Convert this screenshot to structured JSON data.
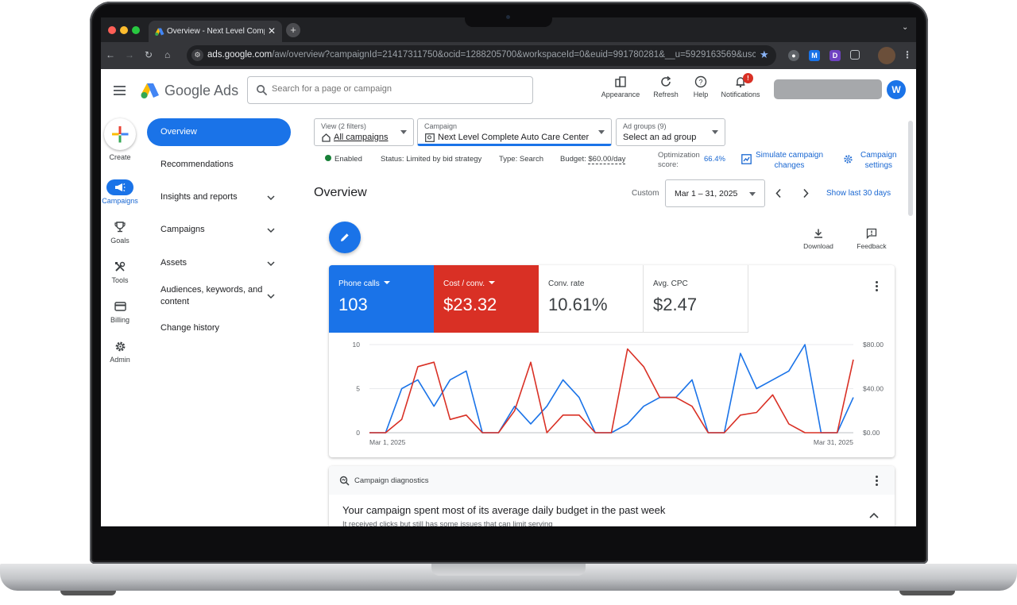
{
  "browser": {
    "tab_title": "Overview - Next Level Complete",
    "tab_close": "✕",
    "new_tab": "+",
    "url_host": "ads.google.com",
    "url_path": "/aw/overview?campaignId=21417311750&ocid=1288205700&workspaceId=0&euid=991780281&__u=5929163569&uscid=128..."
  },
  "header": {
    "brand": "Google Ads",
    "search_placeholder": "Search for a page or campaign",
    "icons": [
      {
        "label": "Appearance",
        "icon": "appearance-icon"
      },
      {
        "label": "Refresh",
        "icon": "refresh-icon"
      },
      {
        "label": "Help",
        "icon": "help-icon"
      },
      {
        "label": "Notifications",
        "icon": "bell-icon",
        "badge": "!"
      }
    ],
    "avatar_letter": "W"
  },
  "rail": {
    "items": [
      {
        "label": "Create",
        "icon": "plus-icon"
      },
      {
        "label": "Campaigns",
        "icon": "megaphone-icon",
        "active": true
      },
      {
        "label": "Goals",
        "icon": "trophy-icon"
      },
      {
        "label": "Tools",
        "icon": "tools-icon"
      },
      {
        "label": "Billing",
        "icon": "credit-card-icon"
      },
      {
        "label": "Admin",
        "icon": "gear-icon"
      }
    ]
  },
  "nav": {
    "items": [
      {
        "label": "Overview",
        "active": true
      },
      {
        "label": "Recommendations"
      },
      {
        "label": "Insights and reports",
        "expandable": true
      },
      {
        "label": "Campaigns",
        "expandable": true
      },
      {
        "label": "Assets",
        "expandable": true
      },
      {
        "label": "Audiences, keywords, and content",
        "expandable": true
      },
      {
        "label": "Change history"
      }
    ]
  },
  "filters": {
    "view_label": "View (2 filters)",
    "view_value": "All campaigns",
    "campaign_label": "Campaign",
    "campaign_value": "Next Level Complete Auto Care Center",
    "adgroup_label": "Ad groups (9)",
    "adgroup_value": "Select an ad group"
  },
  "status": {
    "enabled": "Enabled",
    "status": "Status: Limited by bid strategy",
    "type": "Type: Search",
    "budget_label": "Budget:",
    "budget_value": "$60.00/day",
    "opt_label_1": "Optimization",
    "opt_label_2": "score:",
    "opt_value": "66.4%",
    "simulate_1": "Simulate campaign",
    "simulate_2": "changes",
    "settings_1": "Campaign",
    "settings_2": "settings"
  },
  "overview": {
    "title": "Overview",
    "custom": "Custom",
    "date_range": "Mar 1 – 31, 2025",
    "show_last": "Show last 30 days",
    "download": "Download",
    "feedback": "Feedback"
  },
  "metrics": [
    {
      "label": "Phone calls",
      "value": "103",
      "color": "#1a73e8",
      "dropdown": true
    },
    {
      "label": "Cost / conv.",
      "value": "$23.32",
      "color": "#d93025",
      "dropdown": true
    },
    {
      "label": "Conv. rate",
      "value": "10.61%",
      "color": "#ffffff"
    },
    {
      "label": "Avg. CPC",
      "value": "$2.47",
      "color": "#ffffff"
    }
  ],
  "chart_data": {
    "type": "line",
    "x_start_label": "Mar 1, 2025",
    "x_end_label": "Mar 31, 2025",
    "y_left_ticks": [
      "10",
      "5",
      "0"
    ],
    "y_right_ticks": [
      "$80.00",
      "$40.00",
      "$0.00"
    ],
    "ylim_left": [
      0,
      10
    ],
    "ylim_right": [
      0,
      80
    ],
    "series": [
      {
        "name": "Phone calls",
        "color": "#1a73e8",
        "axis": "left",
        "values": [
          0,
          0,
          5,
          6,
          3,
          6,
          7,
          0,
          0,
          3,
          1,
          3,
          6,
          4,
          0,
          0,
          1,
          3,
          4,
          4,
          6,
          0,
          0,
          9,
          5,
          6,
          7,
          10,
          0,
          0,
          4
        ]
      },
      {
        "name": "Cost / conv.",
        "color": "#d93025",
        "axis": "left",
        "values": [
          0,
          0,
          1.5,
          7.5,
          8,
          1.5,
          2,
          0,
          0,
          2.5,
          8,
          0,
          2,
          2,
          0,
          0,
          9.5,
          7.5,
          4,
          4,
          3,
          0,
          0,
          2,
          2.3,
          4.3,
          1,
          0,
          0,
          0,
          8.3
        ]
      }
    ]
  },
  "diagnostics": {
    "header": "Campaign diagnostics",
    "title": "Your campaign spent most of its average daily budget in the past week",
    "subtitle": "It received clicks but still has some issues that can limit serving"
  }
}
